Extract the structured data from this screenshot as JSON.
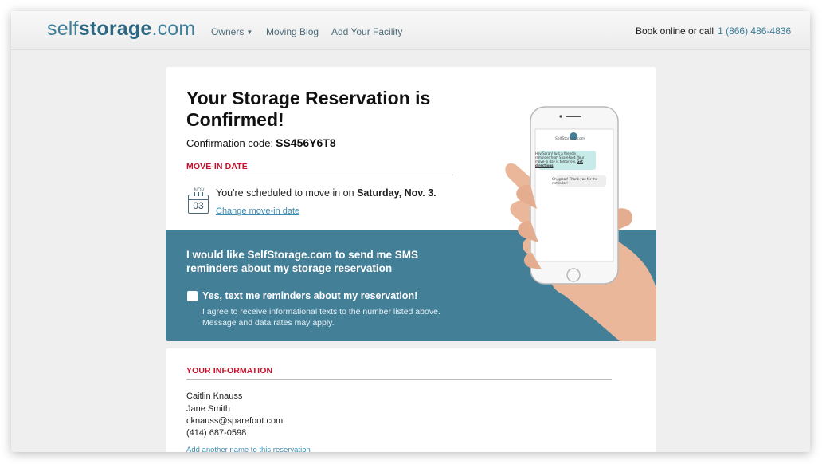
{
  "header": {
    "logo_light": "self",
    "logo_bold": "storage",
    "logo_suffix": ".com",
    "nav": {
      "owners": "Owners",
      "blog": "Moving Blog",
      "add_facility": "Add Your Facility"
    },
    "contact_text": "Book online or call",
    "phone": "1 (866) 486-4836"
  },
  "confirmation": {
    "title": "Your Storage Reservation is Confirmed!",
    "code_label": "Confirmation code:",
    "code": "SS456Y6T8"
  },
  "move_in": {
    "section_label": "MOVE-IN DATE",
    "calendar_month": "NOV",
    "calendar_day": "03",
    "scheduled_text": "You're scheduled to move in on",
    "date": "Saturday, Nov. 3.",
    "change_link": "Change move-in date"
  },
  "sms": {
    "heading": "I would like SelfStorage.com to send me SMS reminders about my storage reservation",
    "checkbox_label": "Yes, text me reminders about my reservation!",
    "checkbox_checked": false,
    "disclaimer": "I agree to receive informational texts to the number listed above. Message and data rates may apply."
  },
  "phone_screen": {
    "brand": "SelfStorage.com",
    "message_in": "Hey Sarah! Just a friendly reminder from SpareFoot: Your move-in day is tomorrow.",
    "message_link": "Get directions",
    "message_out": "Oh, great! Thank you for the reminder!"
  },
  "your_info": {
    "section_label": "YOUR INFORMATION",
    "name_1": "Caitlin Knauss",
    "name_2": "Jane Smith",
    "email": "cknauss@sparefoot.com",
    "phone": "(414) 687-0598",
    "add_link": "Add another name to this reservation"
  },
  "colors": {
    "brand_blue": "#447f98",
    "accent_red": "#c8102e",
    "link_blue": "#3c8cb0",
    "page_bg": "#efefef"
  },
  "icons": [
    "calendar-icon",
    "caret-down-icon",
    "checkbox-icon"
  ]
}
